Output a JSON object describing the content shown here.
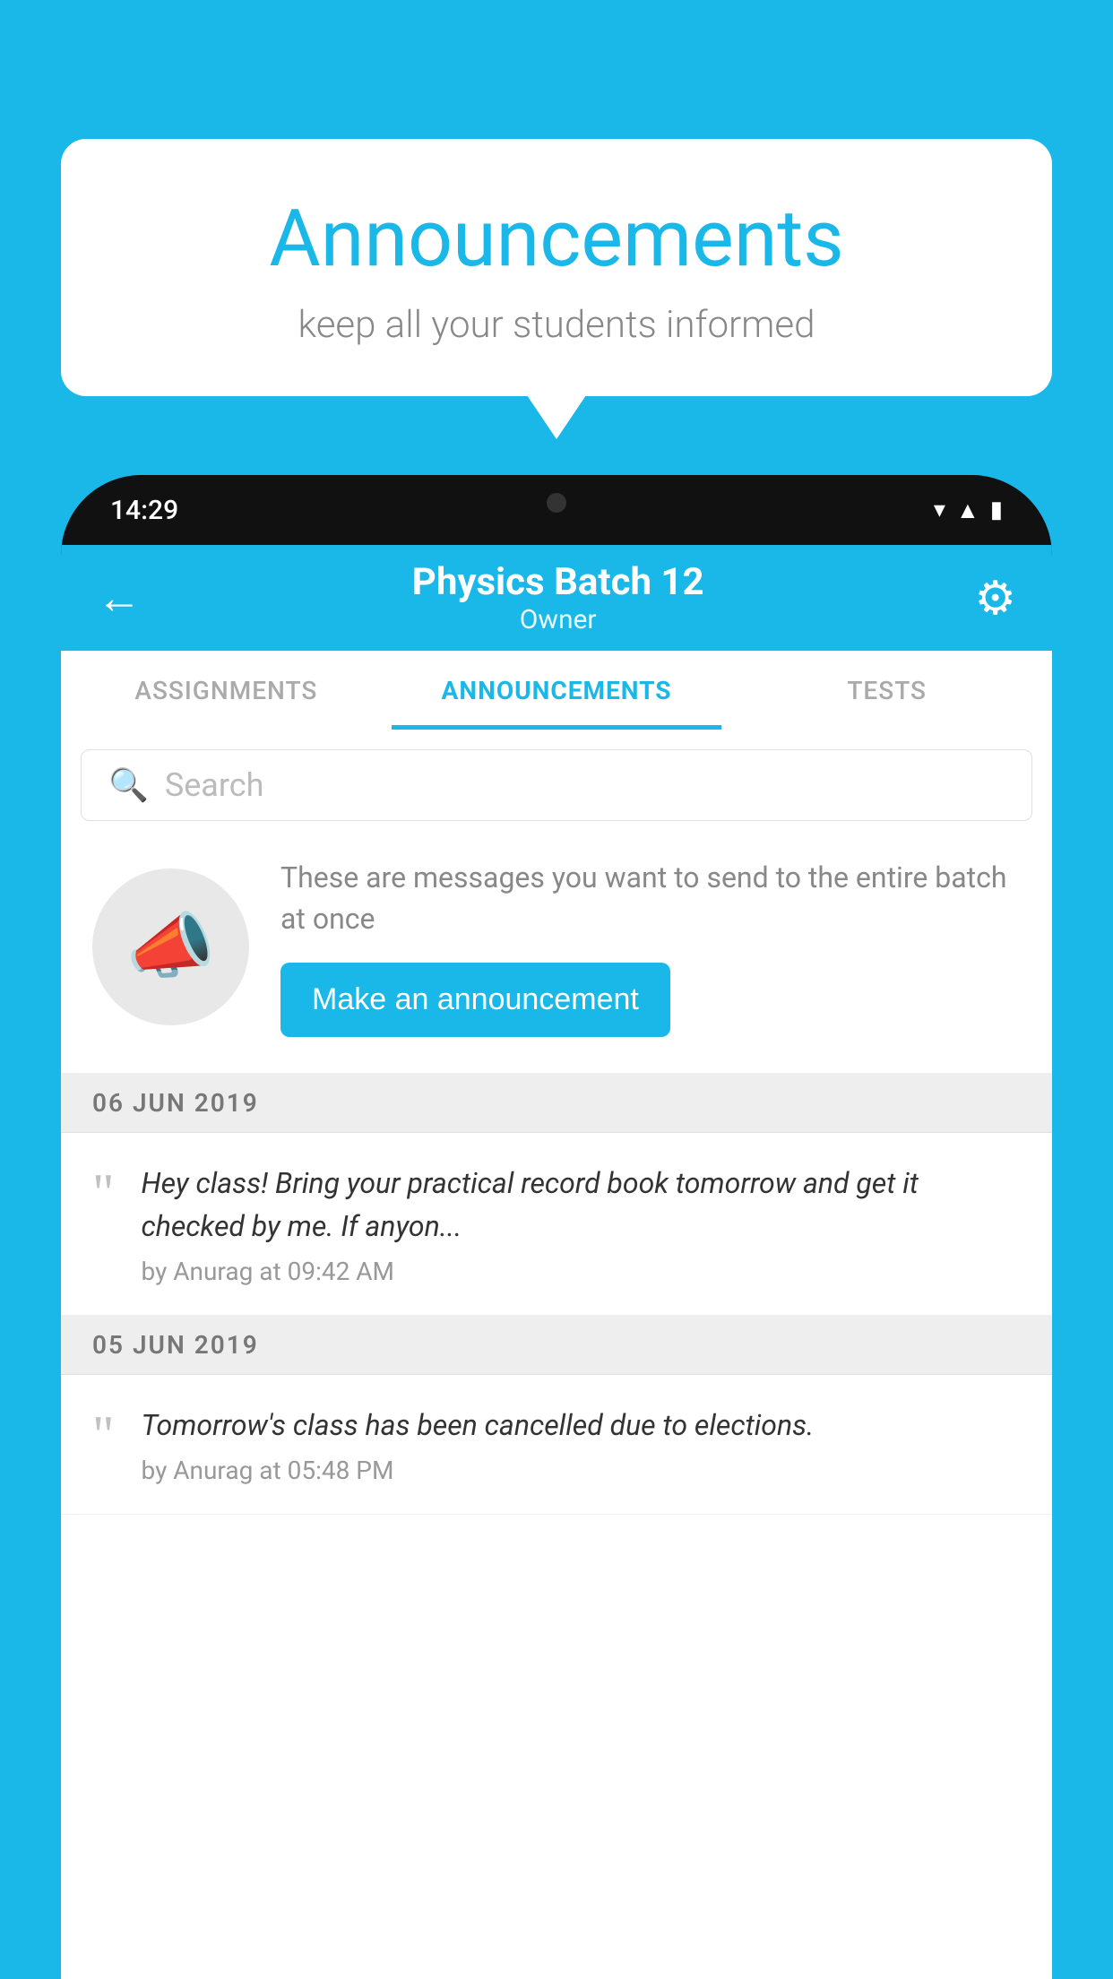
{
  "background_color": "#1ab8e8",
  "speech_bubble": {
    "title": "Announcements",
    "subtitle": "keep all your students informed"
  },
  "status_bar": {
    "time": "14:29",
    "icons": [
      "wifi",
      "signal",
      "battery"
    ]
  },
  "app_bar": {
    "title": "Physics Batch 12",
    "subtitle": "Owner",
    "back_label": "←",
    "gear_label": "⚙"
  },
  "tabs": [
    {
      "label": "ASSIGNMENTS",
      "active": false
    },
    {
      "label": "ANNOUNCEMENTS",
      "active": true
    },
    {
      "label": "TESTS",
      "active": false
    }
  ],
  "search": {
    "placeholder": "Search"
  },
  "promo": {
    "description": "These are messages you want to send to the entire batch at once",
    "button_label": "Make an announcement"
  },
  "announcements": [
    {
      "date": "06  JUN  2019",
      "text": "Hey class! Bring your practical record book tomorrow and get it checked by me. If anyon...",
      "meta": "by Anurag at 09:42 AM"
    },
    {
      "date": "05  JUN  2019",
      "text": "Tomorrow's class has been cancelled due to elections.",
      "meta": "by Anurag at 05:48 PM"
    }
  ]
}
